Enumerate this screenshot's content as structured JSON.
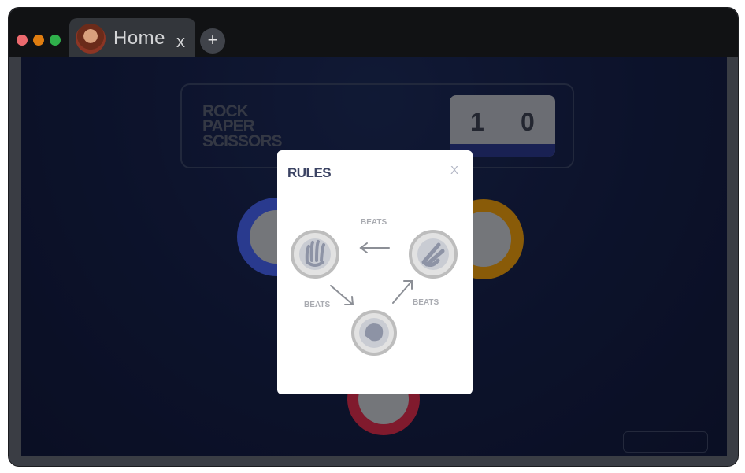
{
  "browser": {
    "tab": {
      "title": "Home",
      "close_label": "x"
    },
    "new_tab_label": "+"
  },
  "game": {
    "title_lines": [
      "ROCK",
      "PAPER",
      "SCISSORS"
    ],
    "score": {
      "left_label": "",
      "right_label": "",
      "left_value": "1",
      "right_value": "0"
    }
  },
  "rules_modal": {
    "title": "RULES",
    "close_label": "X",
    "beats_labels": [
      "BEATS",
      "BEATS",
      "BEATS"
    ]
  },
  "colors": {
    "background": "#16204a",
    "paper_ring": "#4865f4",
    "scissors_ring": "#ec9e0e",
    "rock_ring": "#dc2e4e",
    "modal_icon_ring": "#bdbdbd"
  }
}
